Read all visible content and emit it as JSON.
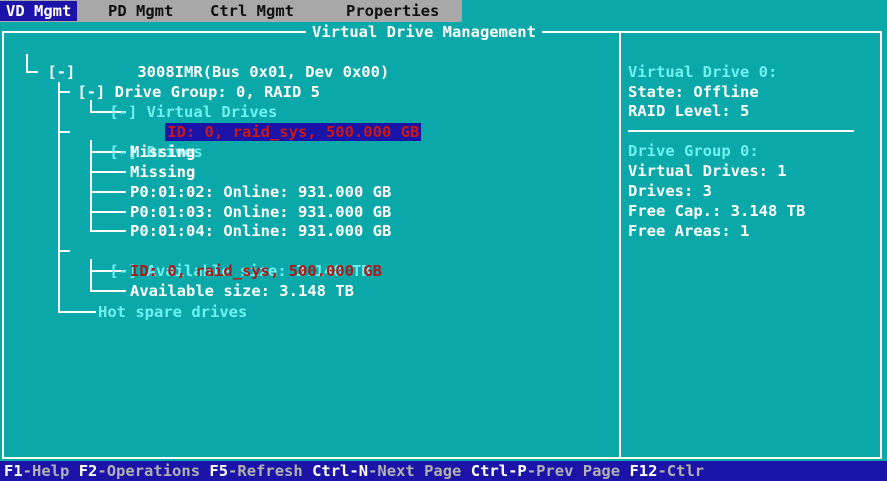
{
  "menu": {
    "tabs": [
      {
        "label": "VD Mgmt",
        "active": true
      },
      {
        "label": "PD Mgmt",
        "active": false
      },
      {
        "label": "Ctrl Mgmt",
        "active": false
      },
      {
        "label": "Properties",
        "active": false
      }
    ]
  },
  "panel": {
    "title": "Virtual Drive Management"
  },
  "tree": {
    "controller": {
      "toggle": "[-]",
      "label": "3008IMR(Bus 0x01, Dev 0x00)"
    },
    "drive_group": {
      "toggle": "[-]",
      "label": "Drive Group: 0, RAID 5"
    },
    "virtual_drives": {
      "toggle": "[-]",
      "label": "Virtual Drives"
    },
    "vd_entry": "ID: 0, raid_sys, 500.000 GB",
    "drives": {
      "toggle": "[-]",
      "label": "Drives"
    },
    "drive_items": [
      "Missing",
      "Missing",
      "P0:01:02: Online: 931.000 GB",
      "P0:01:03: Online: 931.000 GB",
      "P0:01:04: Online: 931.000 GB"
    ],
    "available": {
      "toggle": "[-]",
      "label": "Available size: 3.148 TB"
    },
    "available_items": [
      "ID: 0, raid_sys, 500.000 GB",
      "Available size: 3.148 TB"
    ],
    "hot_spare": "Hot spare drives"
  },
  "info": {
    "vd_title": "Virtual Drive 0:",
    "vd_state": "State: Offline",
    "vd_raid": "RAID Level: 5",
    "dg_title": "Drive Group 0:",
    "dg_vds": "Virtual Drives: 1",
    "dg_drives": "Drives: 3",
    "dg_free_cap": "Free Cap.: 3.148 TB",
    "dg_free_areas": "Free Areas: 1"
  },
  "statusbar": {
    "items": [
      {
        "key": "F1",
        "label": "Help"
      },
      {
        "key": "F2",
        "label": "Operations"
      },
      {
        "key": "F5",
        "label": "Refresh"
      },
      {
        "key": "Ctrl-N",
        "label": "Next Page"
      },
      {
        "key": "Ctrl-P",
        "label": "Prev Page"
      },
      {
        "key": "F12",
        "label": "Ctlr"
      }
    ]
  },
  "colors": {
    "background": "#0aa8a8",
    "highlight": "#1c14a8",
    "menubar": "#a8a8a8",
    "inactive_text": "#6ff0f0",
    "error_text": "#b01818"
  }
}
